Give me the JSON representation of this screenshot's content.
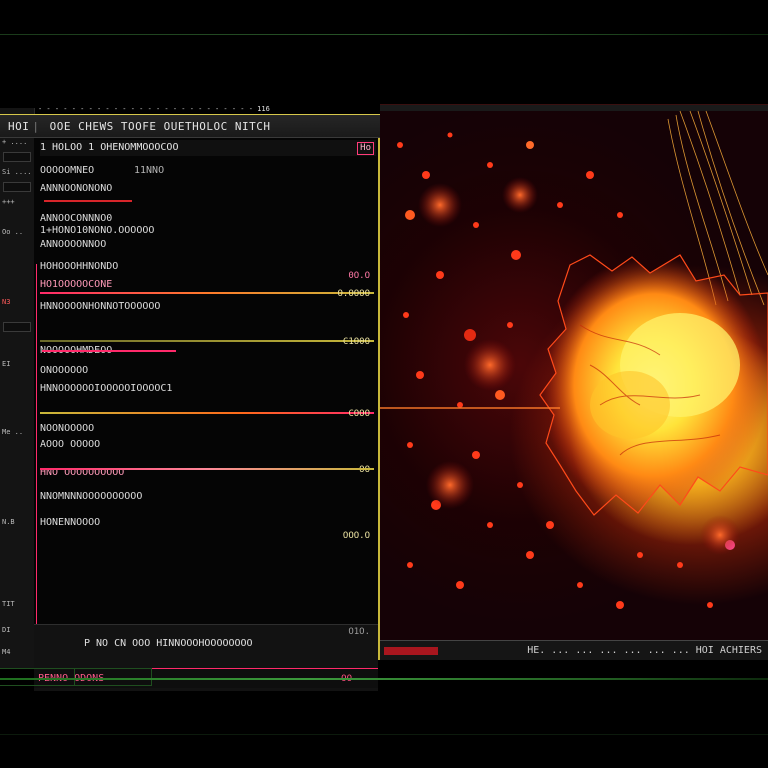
{
  "window": {
    "title_strip": "- - - - - - - - - - - - - - - - - - - - - - - - - -",
    "title_num": "116"
  },
  "menubar": {
    "items": [
      "HOI",
      "OOE",
      "CHEWS",
      "TOOFE",
      "OUETHOLOC",
      "NITCH"
    ]
  },
  "sidebar": {
    "rows": [
      "+ ....",
      "Si ....",
      "+++",
      "Oo ..",
      "N3",
      "EI",
      "Me ..",
      "N.B",
      "TIT",
      "DI",
      "M4"
    ]
  },
  "panel": {
    "header": "1 HOLOO 1 OHENOMMOOOCOO",
    "header_badge": "Ho",
    "lines": [
      "OOOOOMNEO",
      "11NNO",
      "ANNNOONONONO",
      "ANNOOCONNNO0",
      "1+HONO10NONO.OOOOOO",
      "ANNOOOONNOO",
      "HOHOOOHHNONDO",
      "HO1OOOOOCONE",
      "HNNOOOONHONNOTOOOOOO",
      "NOOOOOHMDEOO",
      "ONOOOOOO",
      "HNNOOOOOOIOOOOOIOOOOC1",
      "NOONOOOOO",
      "AOOO OOOOO",
      "HNO OOOOOOOOOO",
      "NNOMNNNOOOOOOOOOO",
      "HONENNOOOO"
    ],
    "right_tags": [
      "0O.O",
      "O.OOOO",
      "C1O0O",
      "COOO",
      "OO",
      "OOO.O"
    ],
    "footer_text": "P NO CN OOO HINNOOOHOOOOOOOO",
    "footer_right": "O1O.",
    "status": "PENNO ODONS",
    "status_page": "OO"
  },
  "viewport": {
    "status_message": "HE.  ... ... ... ... ... ... HOI ACHIERS"
  },
  "colors": {
    "accent_yellow": "#c8b83a",
    "accent_pink": "#ff2a6a",
    "accent_green": "#3c9a3c",
    "heat_core": "#fff450",
    "heat_mid": "#ff7a14",
    "heat_edge": "#c8200e"
  }
}
